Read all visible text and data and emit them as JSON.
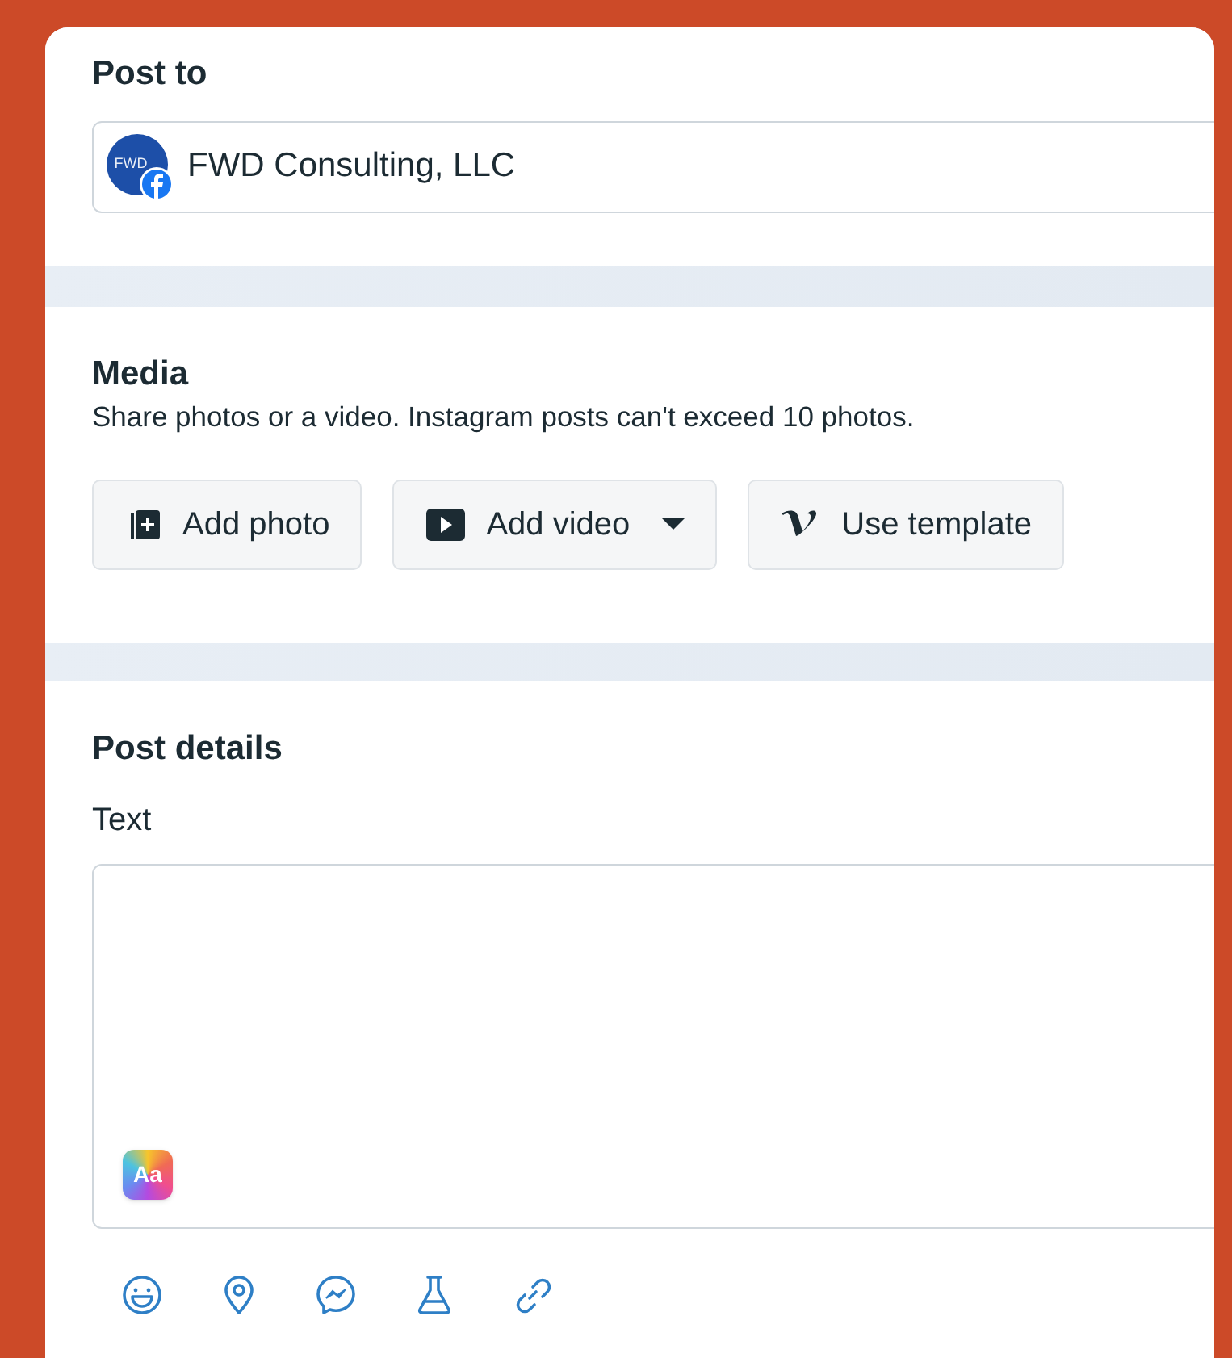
{
  "post_to": {
    "title": "Post to",
    "account": {
      "avatar_text": "FWD",
      "name": "FWD Consulting, LLC"
    }
  },
  "media": {
    "title": "Media",
    "description": "Share photos or a video. Instagram posts can't exceed 10 photos.",
    "buttons": [
      {
        "kind": "photo",
        "label": "Add photo",
        "dropdown": false
      },
      {
        "kind": "video",
        "label": "Add video",
        "dropdown": true
      },
      {
        "kind": "template",
        "label": "Use template",
        "dropdown": false
      }
    ]
  },
  "post_details": {
    "title": "Post details",
    "text_label": "Text",
    "text_style_badge": "Aa",
    "tools": [
      {
        "kind": "emoji"
      },
      {
        "kind": "location"
      },
      {
        "kind": "messenger"
      },
      {
        "kind": "flask"
      },
      {
        "kind": "link"
      }
    ]
  }
}
